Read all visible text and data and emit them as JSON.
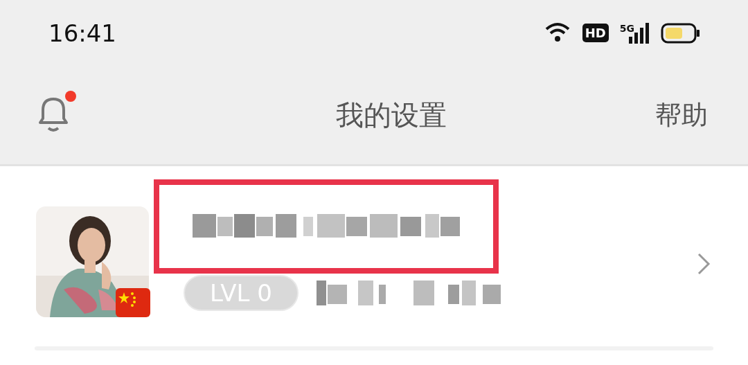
{
  "status_bar": {
    "time": "16:41",
    "hd_badge": "HD",
    "network": "5G"
  },
  "header": {
    "title": "我的设置",
    "help": "帮助",
    "has_unread": true
  },
  "profile": {
    "level": "LVL 0",
    "highlighted": true
  }
}
